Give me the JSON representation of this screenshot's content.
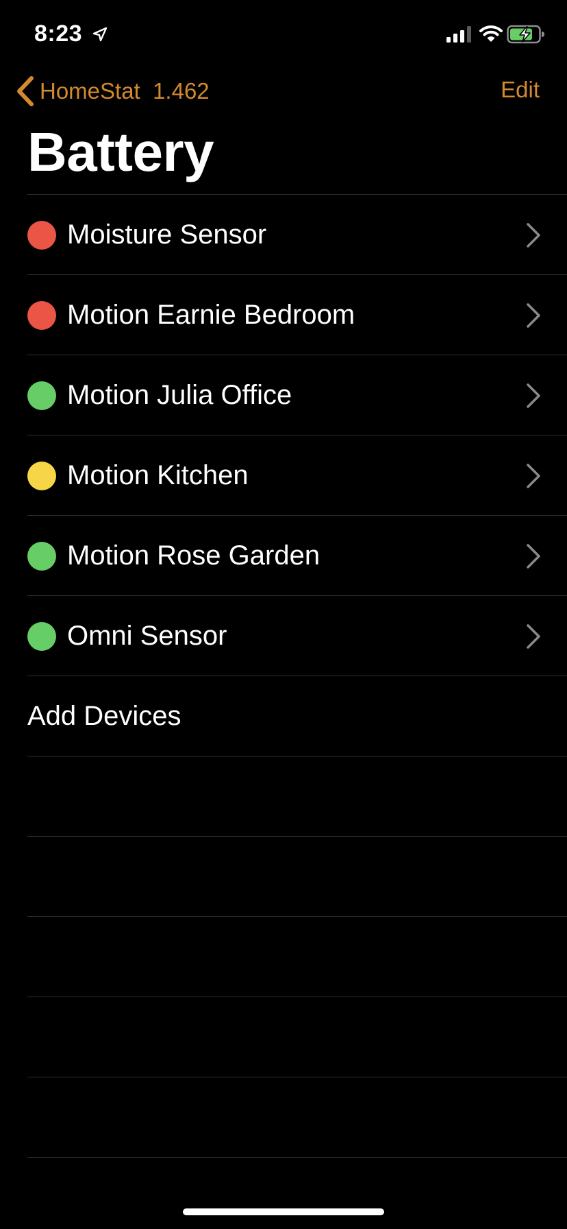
{
  "status_bar": {
    "time": "8:23"
  },
  "nav": {
    "back_label": "HomeStat  1.462",
    "edit_label": "Edit"
  },
  "page": {
    "title": "Battery"
  },
  "colors": {
    "accent": "#d3892d",
    "status_red": "#eb5545",
    "status_green": "#67ce67",
    "status_yellow": "#f6d548",
    "separator": "#2e2e30"
  },
  "devices": [
    {
      "label": "Moisture Sensor",
      "status": "red"
    },
    {
      "label": "Motion Earnie Bedroom",
      "status": "red"
    },
    {
      "label": "Motion Julia Office",
      "status": "green"
    },
    {
      "label": "Motion Kitchen",
      "status": "yellow"
    },
    {
      "label": "Motion Rose Garden",
      "status": "green"
    },
    {
      "label": "Omni Sensor",
      "status": "green"
    }
  ],
  "add_devices_label": "Add Devices",
  "icons": {
    "location": "location-arrow-icon",
    "signal": "cellular-signal-icon",
    "wifi": "wifi-icon",
    "battery": "battery-charging-icon",
    "back": "chevron-left-icon",
    "disclosure": "chevron-right-icon"
  }
}
